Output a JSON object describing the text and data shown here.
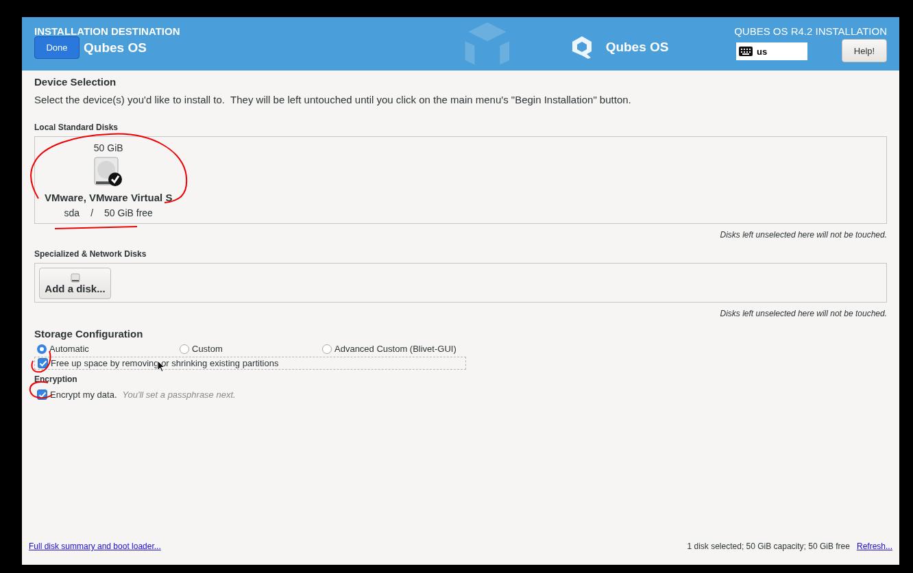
{
  "header": {
    "title": "INSTALLATION DESTINATION",
    "done_button": "Done",
    "brand_left": "Qubes OS",
    "brand": "Qubes OS",
    "product": "QUBES OS R4.2 INSTALLATION",
    "keyboard_layout": "us",
    "help_button": "Help!"
  },
  "device_selection": {
    "heading": "Device Selection",
    "description": "Select the device(s) you'd like to install to.  They will be left untouched until you click on the main menu's \"Begin Installation\" button."
  },
  "local_disks": {
    "heading": "Local Standard Disks",
    "disks": [
      {
        "size": "50 GiB",
        "name": "VMware, VMware Virtual S",
        "device": "sda",
        "separator": "/",
        "free": "50 GiB free",
        "selected": true
      }
    ],
    "note": "Disks left unselected here will not be touched."
  },
  "specialized_disks": {
    "heading": "Specialized & Network Disks",
    "add_button": "Add a disk...",
    "note": "Disks left unselected here will not be touched."
  },
  "storage_configuration": {
    "heading": "Storage Configuration",
    "options": [
      {
        "label": "Automatic",
        "selected": true
      },
      {
        "label": "Custom",
        "selected": false
      },
      {
        "label": "Advanced Custom (Blivet-GUI)",
        "selected": false
      }
    ],
    "free_space": {
      "label": "Free up space by removing or shrinking existing partitions",
      "checked": true
    }
  },
  "encryption": {
    "heading": "Encryption",
    "label": "Encrypt my data.",
    "hint": "You'll set a passphrase next.",
    "checked": true
  },
  "footer": {
    "summary_link": "Full disk summary and boot loader...",
    "status": "1 disk selected; 50 GiB capacity; 50 GiB free",
    "refresh_link": "Refresh..."
  }
}
